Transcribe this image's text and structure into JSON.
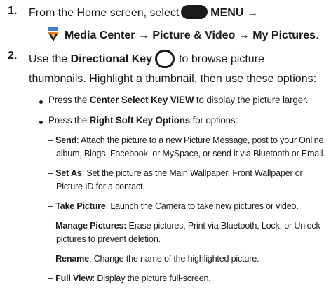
{
  "step1": {
    "num": "1.",
    "pre": "From the Home screen, select",
    "menu_label": "MENU",
    "arrow": "→",
    "path_a": "Media Center",
    "path_b": "Picture & Video",
    "path_c": "My Pictures",
    "end": "."
  },
  "step2": {
    "num": "2.",
    "pre": "Use the",
    "key_name": "Directional Key",
    "post": "to browse picture",
    "line2": "thumbnails. Highlight a thumbnail, then use these options:"
  },
  "bullets": [
    {
      "pre": "Press the",
      "key": "Center Select Key VIEW",
      "post": "to display the picture larger."
    },
    {
      "pre": "Press the",
      "key": "Right Soft Key Options",
      "post": "for options:"
    }
  ],
  "options": [
    {
      "term": "Send",
      "sep": ":",
      "text1": "Attach the picture to a new Picture Message, post to your Online",
      "text2": "album, Blogs, Facebook, or MySpace, or send it via Bluetooth or Email."
    },
    {
      "term": "Set As",
      "sep": ":",
      "text1": "Set the picture as the Main Wallpaper, Front Wallpaper or",
      "text2": "Picture ID for a contact."
    },
    {
      "term": "Take Picture",
      "sep": ":",
      "text1": "Launch the Camera to take new pictures or video."
    },
    {
      "term": "Manage Pictures:",
      "sep": "",
      "text1": "Erase pictures, Print via Bluetooth,  Lock, or Unlock",
      "text2": "pictures to prevent deletion."
    },
    {
      "term": "Rename",
      "sep": ":",
      "text1": "Change the name of the highlighted picture."
    },
    {
      "term": "Full View",
      "sep": ":",
      "text1": "Display the picture full-screen."
    }
  ],
  "dash": "–"
}
